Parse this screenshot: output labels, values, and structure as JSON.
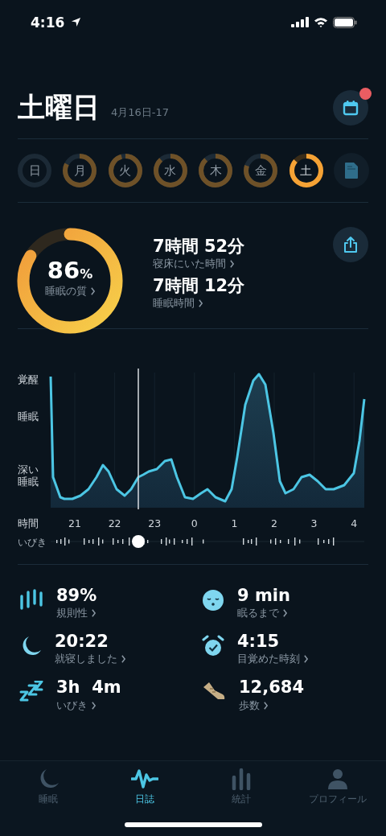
{
  "status_bar": {
    "time": "4:16"
  },
  "header": {
    "title": "土曜日",
    "date": "4月16日-17",
    "calendar_badge": true
  },
  "days": [
    {
      "label": "日",
      "selected": false
    },
    {
      "label": "月",
      "selected": false
    },
    {
      "label": "火",
      "selected": false
    },
    {
      "label": "水",
      "selected": false
    },
    {
      "label": "木",
      "selected": false
    },
    {
      "label": "金",
      "selected": false
    },
    {
      "label": "土",
      "selected": true
    }
  ],
  "summary": {
    "score": "86",
    "score_unit": "%",
    "score_label": "睡眠の質",
    "metrics": [
      {
        "value": "7時間 52分",
        "label": "寝床にいた時間"
      },
      {
        "value": "7時間 12分",
        "label": "睡眠時間"
      }
    ]
  },
  "sleep_graph": {
    "y_labels": [
      "覚醒",
      "睡眠",
      "深い睡眠"
    ],
    "x_title": "時間",
    "x_labels": [
      "21",
      "22",
      "23",
      "0",
      "1",
      "2",
      "3",
      "4"
    ],
    "snore_label": "いびき"
  },
  "stats": [
    {
      "value": "89%",
      "label": "規則性"
    },
    {
      "value": "9 min",
      "label": "眠るまで"
    },
    {
      "value": "20:22",
      "label": "就寝しました"
    },
    {
      "value": "4:15",
      "label": "目覚めた時刻"
    },
    {
      "value": "3h  4m",
      "label": "いびき"
    },
    {
      "value": "12,684",
      "label": "歩数"
    }
  ],
  "tabs": [
    {
      "label": "睡眠",
      "selected": false
    },
    {
      "label": "日誌",
      "selected": true
    },
    {
      "label": "統計",
      "selected": false
    },
    {
      "label": "プロフィール",
      "selected": false
    }
  ]
}
